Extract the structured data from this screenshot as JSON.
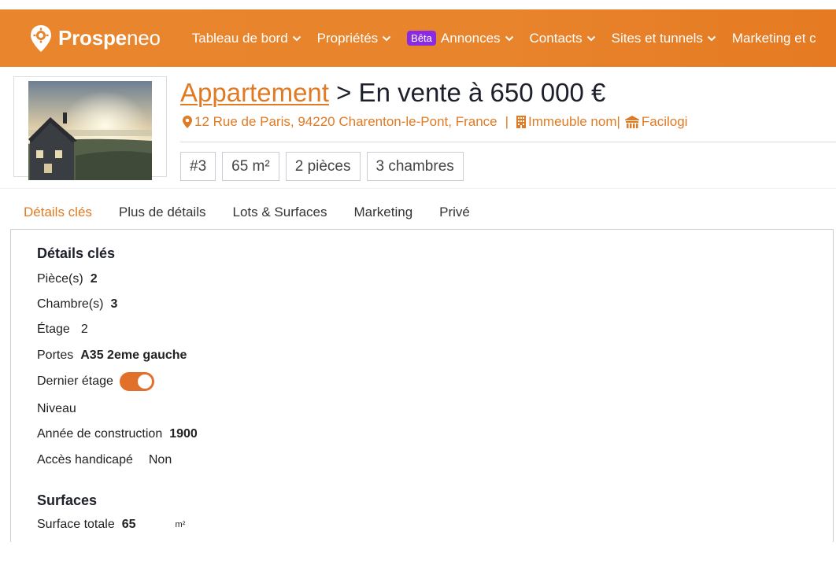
{
  "nav": {
    "brand_bold": "Prospe",
    "brand_light": "neo",
    "items": [
      {
        "label": "Tableau de bord",
        "icon": "chevron-down-icon"
      },
      {
        "label": "Propriétés",
        "icon": "chevron-down-icon"
      },
      {
        "label": "Annonces",
        "badge": "Bêta",
        "icon": "chevron-down-icon"
      },
      {
        "label": "Contacts",
        "icon": "chevron-down-icon"
      },
      {
        "label": "Sites et tunnels",
        "icon": "chevron-down-icon"
      },
      {
        "label": "Marketing et c",
        "icon": ""
      }
    ],
    "colors": {
      "bar": "#e8842c",
      "badge": "#8a2be2"
    }
  },
  "property": {
    "type_link": "Appartement",
    "title_rest": " > En vente à 650 000 €",
    "address": "12 Rue de Paris, 94220 Charenton-le-Pont, France",
    "building": "Immeuble nom|",
    "building_icon": "building-icon",
    "facilogi": "Facilogi",
    "facilogi_icon": "facilogi-icon",
    "tags": [
      "#3",
      "65 m²",
      "2 pièces",
      "3 chambres"
    ],
    "accent_color": "#e07b24"
  },
  "tabs": [
    {
      "label": "Détails clés",
      "active": true
    },
    {
      "label": "Plus de détails",
      "active": false
    },
    {
      "label": "Lots & Surfaces",
      "active": false
    },
    {
      "label": "Marketing",
      "active": false
    },
    {
      "label": "Privé",
      "active": false
    }
  ],
  "details": {
    "section_title": "Détails clés",
    "rows": [
      {
        "label": "Pièce(s)",
        "value": "2"
      },
      {
        "label": "Chambre(s)",
        "value": "3"
      },
      {
        "label": "Étage",
        "value": "2"
      },
      {
        "label": "Portes",
        "value": "A35 2eme gauche"
      },
      {
        "label": "Dernier étage",
        "toggle_on": true
      },
      {
        "label": "Niveau",
        "value": ""
      },
      {
        "label": "Année de construction",
        "value": "1900"
      },
      {
        "label": "Accès handicapé",
        "value": "Non"
      }
    ]
  },
  "surfaces": {
    "section_title": "Surfaces",
    "rows": [
      {
        "label": "Surface totale",
        "value": "65",
        "unit": "m²"
      }
    ]
  }
}
